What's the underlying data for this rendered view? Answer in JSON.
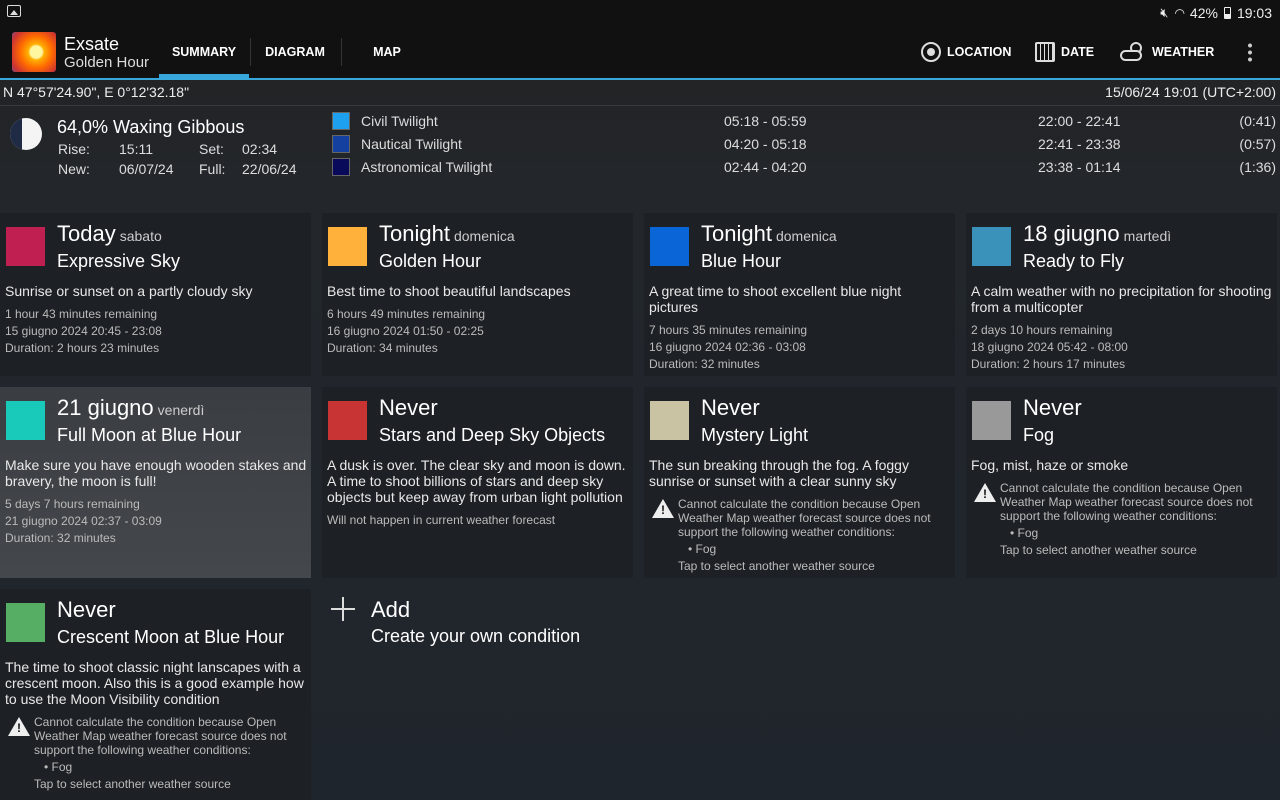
{
  "status": {
    "battery": "42%",
    "time": "19:03"
  },
  "app": {
    "title": "Exsate",
    "subtitle": "Golden Hour"
  },
  "tabs": [
    {
      "label": "SUMMARY",
      "active": true
    },
    {
      "label": "DIAGRAM",
      "active": false
    },
    {
      "label": "MAP",
      "active": false
    }
  ],
  "actions": {
    "location": "LOCATION",
    "date": "DATE",
    "weather": "WEATHER"
  },
  "header": {
    "coordinates": "N 47°57'24.90\", E 0°12'32.18\"",
    "datetime": "15/06/24 19:01 (UTC+2:00)"
  },
  "moon": {
    "phase": "64,0% Waxing Gibbous",
    "rise_label": "Rise:",
    "rise": "15:11",
    "set_label": "Set:",
    "set": "02:34",
    "new_label": "New:",
    "new": "06/07/24",
    "full_label": "Full:",
    "full": "22/06/24"
  },
  "twilight": [
    {
      "name": "Civil Twilight",
      "color": "#1ea0f0",
      "morning": "05:18 - 05:59",
      "evening": "22:00 - 22:41",
      "duration": "(0:41)"
    },
    {
      "name": "Nautical Twilight",
      "color": "#1440a0",
      "morning": "04:20 - 05:18",
      "evening": "22:41 - 23:38",
      "duration": "(0:57)"
    },
    {
      "name": "Astronomical Twilight",
      "color": "#0a0a5a",
      "morning": "02:44 - 04:20",
      "evening": "23:38 - 01:14",
      "duration": "(1:36)"
    }
  ],
  "cards": [
    {
      "color": "#c01f52",
      "when": "Today",
      "day": "sabato",
      "name": "Expressive Sky",
      "desc": "Sunrise or sunset on a partly cloudy sky",
      "info": [
        "1 hour 43 minutes remaining",
        "15 giugno 2024 20:45 - 23:08",
        "Duration: 2 hours 23 minutes"
      ]
    },
    {
      "color": "#ffb13b",
      "when": "Tonight",
      "day": "domenica",
      "name": "Golden Hour",
      "desc": "Best time to shoot beautiful landscapes",
      "info": [
        "6 hours 49 minutes remaining",
        "16 giugno 2024 01:50 - 02:25",
        "Duration: 34 minutes"
      ]
    },
    {
      "color": "#0a66d6",
      "when": "Tonight",
      "day": "domenica",
      "name": "Blue Hour",
      "desc": "A great time to shoot excellent blue night pictures",
      "info": [
        "7 hours 35 minutes remaining",
        "16 giugno 2024 02:36 - 03:08",
        "Duration: 32 minutes"
      ]
    },
    {
      "color": "#3a92bb",
      "when": "18 giugno",
      "day": "martedì",
      "name": "Ready to Fly",
      "desc": "A calm weather with no precipitation for shooting from a multicopter",
      "info": [
        "2 days 10 hours remaining",
        "18 giugno 2024 05:42 - 08:00",
        "Duration: 2 hours 17 minutes"
      ]
    },
    {
      "color": "#19c9b9",
      "when": "21 giugno",
      "day": "venerdì",
      "name": "Full Moon at Blue Hour",
      "desc": "Make sure you have enough wooden stakes and bravery, the moon is full!",
      "info": [
        "5 days 7 hours remaining",
        "21 giugno 2024 02:37 - 03:09",
        "Duration: 32 minutes"
      ]
    },
    {
      "color": "#c83434",
      "when": "Never",
      "day": "",
      "name": "Stars and Deep Sky Objects",
      "desc": "A dusk is over. The clear sky and moon is down. A time to shoot billions of stars and deep sky objects but keep away from urban light pollution",
      "info": [
        "Will not happen in current weather forecast"
      ]
    },
    {
      "color": "#c9c3a3",
      "when": "Never",
      "day": "",
      "name": "Mystery Light",
      "desc": "The sun breaking through the fog. A foggy sunrise or sunset with a clear sunny sky",
      "warning": "Cannot calculate the condition because Open Weather Map weather forecast source does not support the following weather conditions:",
      "bullet": "• Fog",
      "tap": "Tap to select another weather source"
    },
    {
      "color": "#999999",
      "when": "Never",
      "day": "",
      "name": "Fog",
      "desc": "Fog, mist, haze or smoke",
      "warning": "Cannot calculate the condition because Open Weather Map weather forecast source does not support the following weather conditions:",
      "bullet": "• Fog",
      "tap": "Tap to select another weather source"
    },
    {
      "color": "#55ae63",
      "when": "Never",
      "day": "",
      "name": "Crescent Moon at Blue Hour",
      "desc": "The time to shoot classic night lanscapes with a crescent moon. Also this is a good example how to use the Moon Visibility condition",
      "warning": "Cannot calculate the condition because Open Weather Map weather forecast source does not support the following weather conditions:",
      "bullet": "• Fog",
      "tap": "Tap to select another weather source"
    }
  ],
  "add": {
    "title": "Add",
    "subtitle": "Create your own condition"
  }
}
